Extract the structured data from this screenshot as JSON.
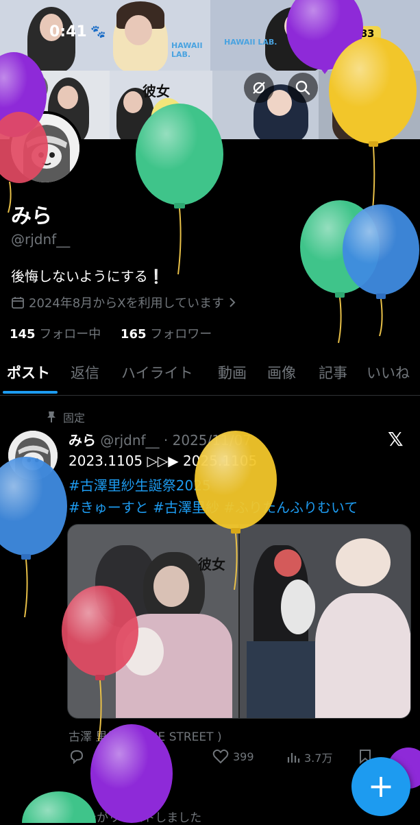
{
  "status_bar": {
    "time": "0:41",
    "battery": "83"
  },
  "banner": {
    "sticker_text": "彼女"
  },
  "profile": {
    "display_name": "みら",
    "handle": "@rjdnf__",
    "bio": "後悔しないようにする❕",
    "joined": "2024年8月からXを利用しています",
    "following_count": "145",
    "following_label": "フォロー中",
    "followers_count": "165",
    "followers_label": "フォロワー"
  },
  "tabs": [
    {
      "label": "ポスト",
      "active": true
    },
    {
      "label": "返信"
    },
    {
      "label": "ハイライト"
    },
    {
      "label": "動画"
    },
    {
      "label": "画像"
    },
    {
      "label": "記事"
    },
    {
      "label": "いいね"
    }
  ],
  "post": {
    "pinned_label": "固定",
    "author": "みら",
    "handle": "@rjdnf__",
    "date": "· 2025/11/07",
    "line1": "2023.1105 ▷▷▶ 2025.1105",
    "hashtag1": "#古澤里紗生誕祭2025",
    "hashtag2": "#きゅーすと",
    "hashtag3": "#古澤里紗",
    "hashtag4": "#ふりたんふりむいて",
    "media_sticker": "彼女",
    "tagged_user": "古澤 里紗 ( CUTIE STREET )",
    "retweets": "0",
    "likes": "399",
    "views": "3.7万",
    "reposted_label": "あなたがリポストしました"
  },
  "colors": {
    "accent": "#1d9bf0",
    "balloon_purple": "#8e2ad8",
    "balloon_yellow": "#f2c62a",
    "balloon_green": "#3fc48a",
    "balloon_blue": "#3f8be0",
    "balloon_red": "#e24a63"
  }
}
